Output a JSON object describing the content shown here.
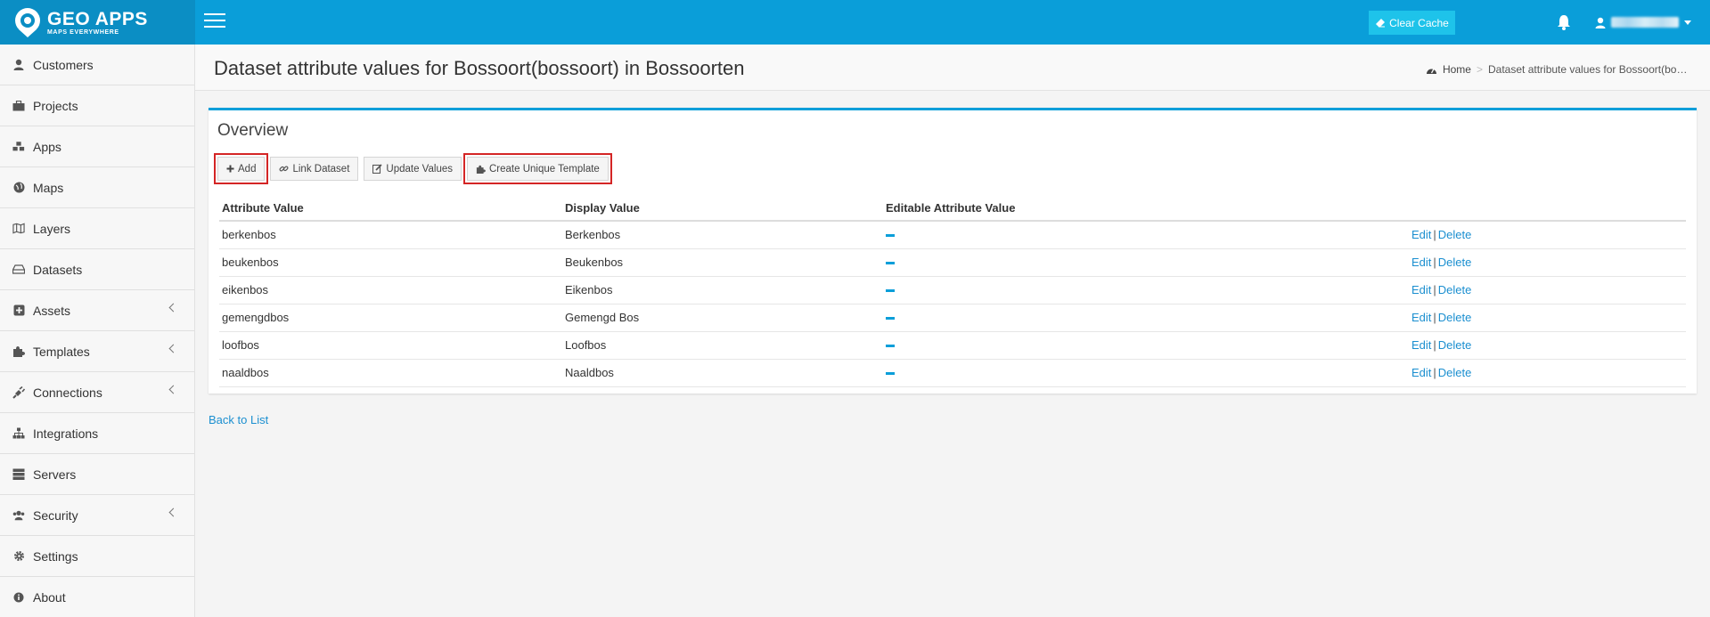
{
  "brand": {
    "title": "GEO APPS",
    "subtitle": "MAPS EVERYWHERE"
  },
  "header": {
    "clear_cache_label": "Clear Cache"
  },
  "sidebar": {
    "items": [
      {
        "label": "Customers",
        "icon": "user-icon",
        "has_submenu": false
      },
      {
        "label": "Projects",
        "icon": "briefcase-icon",
        "has_submenu": false
      },
      {
        "label": "Apps",
        "icon": "cubes-icon",
        "has_submenu": false
      },
      {
        "label": "Maps",
        "icon": "globe-icon",
        "has_submenu": false
      },
      {
        "label": "Layers",
        "icon": "map-icon",
        "has_submenu": false
      },
      {
        "label": "Datasets",
        "icon": "hdd-icon",
        "has_submenu": false
      },
      {
        "label": "Assets",
        "icon": "plus-square-icon",
        "has_submenu": true
      },
      {
        "label": "Templates",
        "icon": "puzzle-icon",
        "has_submenu": true
      },
      {
        "label": "Connections",
        "icon": "plug-icon",
        "has_submenu": true
      },
      {
        "label": "Integrations",
        "icon": "sitemap-icon",
        "has_submenu": false
      },
      {
        "label": "Servers",
        "icon": "server-icon",
        "has_submenu": false
      },
      {
        "label": "Security",
        "icon": "users-icon",
        "has_submenu": true
      },
      {
        "label": "Settings",
        "icon": "gear-icon",
        "has_submenu": false
      },
      {
        "label": "About",
        "icon": "info-icon",
        "has_submenu": false
      }
    ]
  },
  "page": {
    "title": "Dataset attribute values for Bossoort(bossoort) in Bossoorten",
    "breadcrumb": {
      "home": "Home",
      "current": "Dataset attribute values for Bossoort(bossoort)"
    }
  },
  "panel": {
    "title": "Overview",
    "buttons": {
      "add": "Add",
      "link_dataset": "Link Dataset",
      "update_values": "Update Values",
      "create_unique_template": "Create Unique Template"
    },
    "columns": [
      "Attribute Value",
      "Display Value",
      "Editable Attribute Value",
      ""
    ],
    "rows": [
      {
        "attribute": "berkenbos",
        "display": "Berkenbos"
      },
      {
        "attribute": "beukenbos",
        "display": "Beukenbos"
      },
      {
        "attribute": "eikenbos",
        "display": "Eikenbos"
      },
      {
        "attribute": "gemengdbos",
        "display": "Gemengd Bos"
      },
      {
        "attribute": "loofbos",
        "display": "Loofbos"
      },
      {
        "attribute": "naaldbos",
        "display": "Naaldbos"
      }
    ],
    "row_actions": {
      "edit": "Edit",
      "separator": "|",
      "delete": "Delete"
    }
  },
  "back_link": "Back to List",
  "colors": {
    "header": "#0a9ed9",
    "logo_bg": "#0b8ec4",
    "clear_cache": "#1ec3ea",
    "link": "#1b8fd0",
    "highlight": "#d42525"
  }
}
